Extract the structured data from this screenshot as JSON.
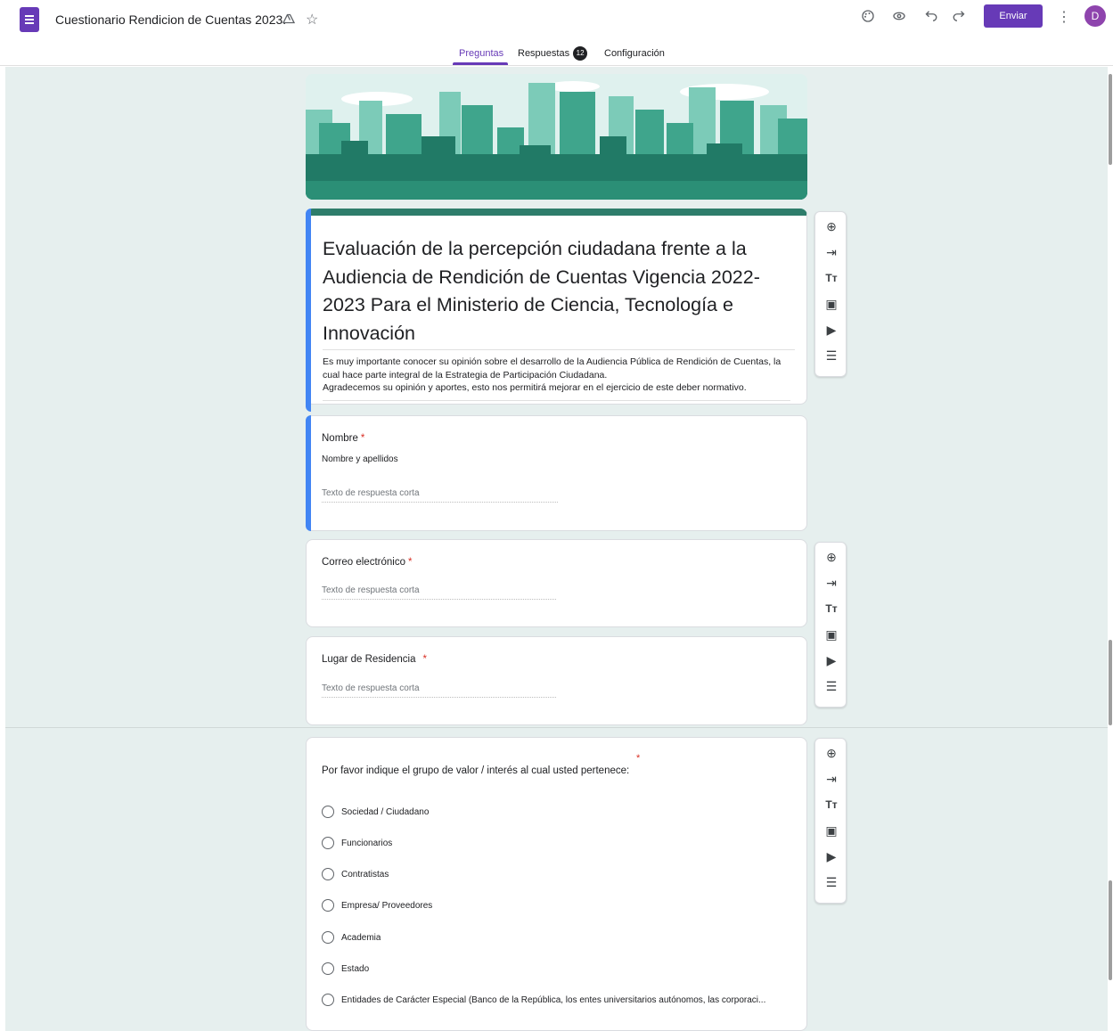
{
  "app": {
    "title": "Cuestionario Rendicion de Cuentas 2023.",
    "send_label": "Enviar",
    "avatar_initial": "D",
    "icons": [
      "palette-icon",
      "preview-eye-icon",
      "undo-icon",
      "redo-icon",
      "more-vert-icon",
      "move-to-folder-icon",
      "star-icon"
    ]
  },
  "tabs": [
    {
      "label": "Preguntas",
      "active": true
    },
    {
      "label": "Respuestas",
      "badge": "12"
    },
    {
      "label": "Configuración"
    }
  ],
  "form": {
    "title": "Evaluación de la percepción ciudadana frente a la Audiencia de Rendición de Cuentas Vigencia 2022-2023 Para el Ministerio de Ciencia, Tecnología e Innovación",
    "description_line1": "Es muy importante conocer su opinión sobre el desarrollo de la Audiencia Pública de Rendición de Cuentas, la cual hace parte integral de la Estrategia de Participación Ciudadana.",
    "description_line2": "Agradecemos su opinión y aportes, esto nos permitirá mejorar en el ejercicio de este deber normativo."
  },
  "questions": [
    {
      "label": "Nombre",
      "required": "*",
      "subtitle": "Nombre y apellidos",
      "answer_placeholder": "Texto de respuesta corta"
    },
    {
      "label": "Correo electrónico",
      "required": "*",
      "answer_placeholder": "Texto de respuesta corta"
    },
    {
      "label": "Lugar de Residencia",
      "required": "*",
      "answer_placeholder": "Texto de respuesta corta"
    },
    {
      "label": "Por favor indique el grupo de valor / interés al cual usted pertenece:",
      "required": "*",
      "options": [
        "Sociedad / Ciudadano",
        "Funcionarios",
        "Contratistas",
        "Empresa/ Proveedores",
        "Academia",
        "Estado",
        "Entidades de Carácter Especial (Banco de la República, los entes universitarios autónomos, las corporaci..."
      ]
    }
  ],
  "side_toolbar_icons": [
    "add-question-icon",
    "import-questions-icon",
    "add-title-icon",
    "add-image-icon",
    "add-video-icon",
    "add-section-icon"
  ],
  "colors": {
    "accent": "#673ab7",
    "header_bar": "#2e7d6b",
    "active_bar": "#4285f4",
    "canvas_bg": "#e6efee",
    "required": "#d93025"
  }
}
